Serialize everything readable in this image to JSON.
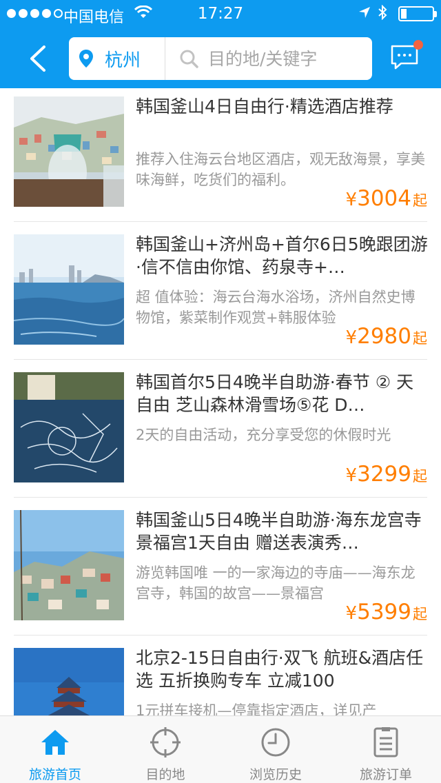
{
  "status": {
    "carrier": "中国电信",
    "time": "17:27"
  },
  "header": {
    "city": "杭州",
    "search_placeholder": "目的地/关键字",
    "has_message_badge": true,
    "accent_color": "#0d9bf0"
  },
  "products": [
    {
      "title": "韩国釜山4日自由行·精选酒店推荐",
      "desc": "推荐入住海云台地区酒店，观无敌海景，享美味海鲜，吃货们的福利。",
      "currency": "¥",
      "price": "3004",
      "suffix": "起"
    },
    {
      "title": "韩国釜山+济州岛+首尔6日5晚跟团游·信不信由你馆、药泉寺+…",
      "desc": "超 值体验：海云台海水浴场，济州自然史博物馆，紫菜制作观赏+韩服体验",
      "currency": "¥",
      "price": "2980",
      "suffix": "起"
    },
    {
      "title": "韩国首尔5日4晚半自助游·春节 ② 天自由 芝山森林滑雪场⑤花 D…",
      "desc": "2天的自由活动，充分享受您的休假时光",
      "currency": "¥",
      "price": "3299",
      "suffix": "起"
    },
    {
      "title": "韩国釜山5日4晚半自助游·海东龙宫寺 景福宫1天自由 赠送表演秀…",
      "desc": "游览韩国唯 一的一家海边的寺庙——海东龙宫寺，韩国的故宫——景福宫",
      "currency": "¥",
      "price": "5399",
      "suffix": "起"
    },
    {
      "title": "北京2-15日自由行·双飞 航班&酒店任选  五折换购专车 立减100",
      "desc": "1元拼车接机—停靠指定酒店，详见产",
      "currency": "",
      "price": "",
      "suffix": ""
    }
  ],
  "tabs": [
    {
      "label": "旅游首页",
      "icon": "home-icon",
      "active": true
    },
    {
      "label": "目的地",
      "icon": "crosshair-icon",
      "active": false
    },
    {
      "label": "浏览历史",
      "icon": "clock-icon",
      "active": false
    },
    {
      "label": "旅游订单",
      "icon": "order-list-icon",
      "active": false
    }
  ],
  "colors": {
    "primary": "#0d9bf0",
    "price": "#ff7e00",
    "badge": "#f26341"
  }
}
